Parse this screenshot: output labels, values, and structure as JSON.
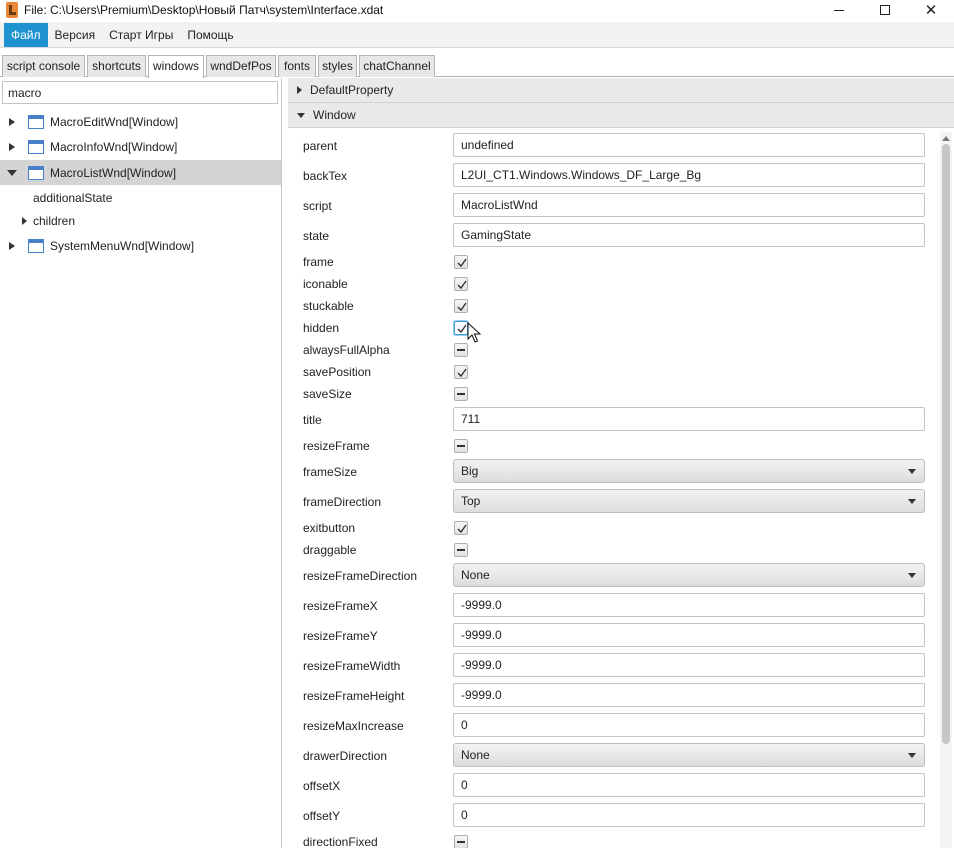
{
  "window": {
    "title": "File: C:\\Users\\Premium\\Desktop\\Новый Патч\\system\\Interface.xdat"
  },
  "menu": [
    {
      "label": "Файл",
      "active": true
    },
    {
      "label": "Версия",
      "active": false
    },
    {
      "label": "Старт Игры",
      "active": false
    },
    {
      "label": "Помощь",
      "active": false
    }
  ],
  "tabs": [
    {
      "label": "script console"
    },
    {
      "label": "shortcuts"
    },
    {
      "label": "windows",
      "selected": true
    },
    {
      "label": "wndDefPos"
    },
    {
      "label": "fonts"
    },
    {
      "label": "styles"
    },
    {
      "label": "chatChannel"
    }
  ],
  "search": {
    "value": "macro"
  },
  "tree": [
    {
      "label": "MacroEditWnd[Window]"
    },
    {
      "label": "MacroInfoWnd[Window]"
    },
    {
      "label": "MacroListWnd[Window]"
    },
    {
      "label": "additionalState"
    },
    {
      "label": "children"
    },
    {
      "label": "SystemMenuWnd[Window]"
    }
  ],
  "sections": {
    "default_property": "DefaultProperty",
    "window": "Window"
  },
  "properties": [
    {
      "label": "parent",
      "value": "undefined"
    },
    {
      "label": "backTex",
      "value": "L2UI_CT1.Windows.Windows_DF_Large_Bg"
    },
    {
      "label": "script",
      "value": "MacroListWnd"
    },
    {
      "label": "state",
      "value": "GamingState"
    },
    {
      "label": "frame",
      "checked": true
    },
    {
      "label": "iconable",
      "checked": true
    },
    {
      "label": "stuckable",
      "checked": true
    },
    {
      "label": "hidden",
      "checked": true
    },
    {
      "label": "alwaysFullAlpha",
      "checked": false
    },
    {
      "label": "savePosition",
      "checked": true
    },
    {
      "label": "saveSize",
      "checked": false
    },
    {
      "label": "title",
      "value": "711"
    },
    {
      "label": "resizeFrame",
      "checked": false
    },
    {
      "label": "frameSize",
      "value": "Big"
    },
    {
      "label": "frameDirection",
      "value": "Top"
    },
    {
      "label": "exitbutton",
      "checked": true
    },
    {
      "label": "draggable",
      "checked": false
    },
    {
      "label": "resizeFrameDirection",
      "value": "None"
    },
    {
      "label": "resizeFrameX",
      "value": "-9999.0"
    },
    {
      "label": "resizeFrameY",
      "value": "-9999.0"
    },
    {
      "label": "resizeFrameWidth",
      "value": "-9999.0"
    },
    {
      "label": "resizeFrameHeight",
      "value": "-9999.0"
    },
    {
      "label": "resizeMaxIncrease",
      "value": "0"
    },
    {
      "label": "drawerDirection",
      "value": "None"
    },
    {
      "label": "offsetX",
      "value": "0"
    },
    {
      "label": "offsetY",
      "value": "0"
    },
    {
      "label": "directionFixed",
      "checked": false
    }
  ],
  "colors": {
    "accent": "#1f93d0",
    "selected_row": "#d4d4d4",
    "focus": "#3a9bd9"
  }
}
